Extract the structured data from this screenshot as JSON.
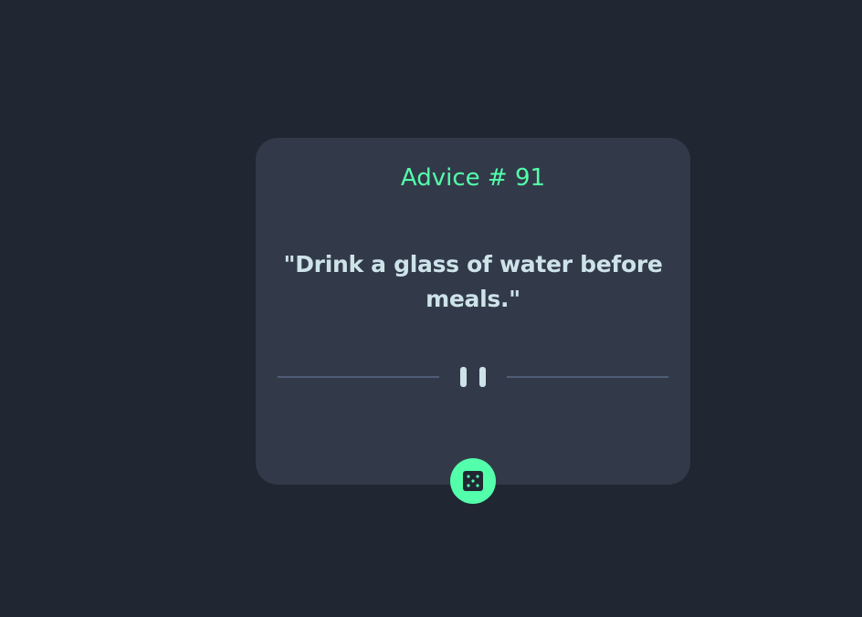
{
  "advice": {
    "heading": "Advice # 91",
    "text": "\"Drink a glass of water before meals.\""
  },
  "divider": {
    "icon": "pause-icon"
  },
  "button": {
    "icon": "dice-icon",
    "accent_color": "#53ffaa"
  },
  "colors": {
    "background": "#202632",
    "card": "#323a49",
    "accent": "#53ffaa",
    "text": "#cee3e9",
    "divider": "#4f5d74"
  }
}
